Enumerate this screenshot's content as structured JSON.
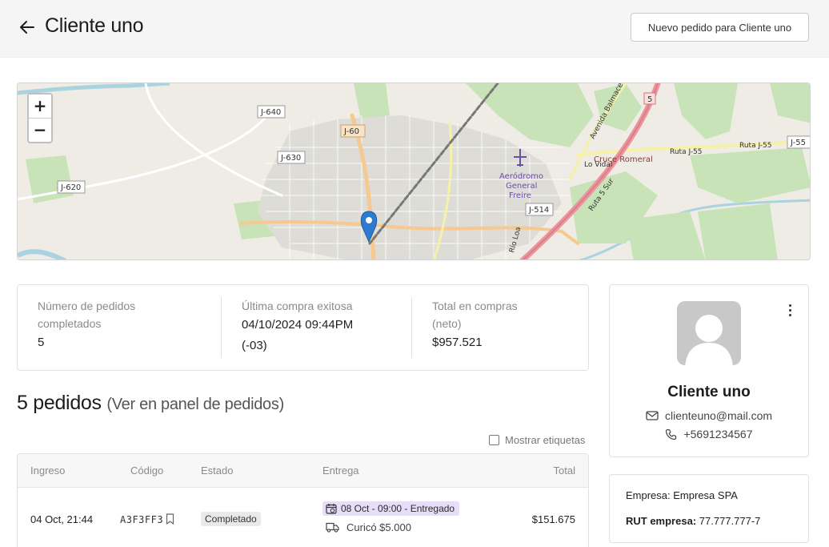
{
  "header": {
    "title": "Cliente uno",
    "new_order_label": "Nuevo pedido para Cliente uno"
  },
  "map": {
    "zoom_in": "+",
    "zoom_out": "−",
    "labels": {
      "j640": "J-640",
      "j630": "J-630",
      "j620": "J-620",
      "j60": "J-60",
      "j514": "J-514",
      "j55": "J-55",
      "r5": "5",
      "ruta_j55": "Ruta J-55",
      "ruta_j55b": "Ruta J-55",
      "avenida": "Avenida Balmaceda",
      "cruce": "Cruce Romeral",
      "lo_vidal": "Lo Vidal",
      "ruta5sur": "Ruta 5 Sur",
      "rio_loa": "Río Loa",
      "aerodromo_1": "Aeródromo",
      "aerodromo_2": "General",
      "aerodromo_3": "Freire"
    }
  },
  "stats": {
    "completed_label_1": "Número de pedidos",
    "completed_label_2": "completados",
    "completed_value": "5",
    "last_label": "Última compra exitosa",
    "last_value_1": "04/10/2024 09:44PM",
    "last_value_2": "(-03)",
    "total_label_1": "Total en compras",
    "total_label_2": "(neto)",
    "total_value": "$957.521"
  },
  "orders": {
    "count_title": "5 pedidos",
    "panel_link": "(Ver en panel de pedidos)",
    "show_tags": "Mostrar etiquetas",
    "columns": {
      "ingreso": "Ingreso",
      "codigo": "Código",
      "estado": "Estado",
      "entrega": "Entrega",
      "total": "Total"
    },
    "rows": [
      {
        "ingreso": "04 Oct, 21:44",
        "codigo": "A3F3FF3",
        "estado": "Completado",
        "entrega_status": "08 Oct - 09:00 - Entregado",
        "entrega_place": "Curicó $5.000",
        "total": "$151.675"
      }
    ]
  },
  "profile": {
    "name": "Cliente uno",
    "email": "clienteuno@mail.com",
    "phone": "+5691234567"
  },
  "company": {
    "empresa_label": "Empresa:",
    "empresa_value": "Empresa SPA",
    "rut_label": "RUT empresa:",
    "rut_value": "77.777.777-7"
  },
  "colors": {
    "header_bg": "#f5f5f6",
    "delivery_pill": "#e7ddf8",
    "status_badge": "#e9e9e9",
    "map_marker": "#2e7ad1"
  }
}
